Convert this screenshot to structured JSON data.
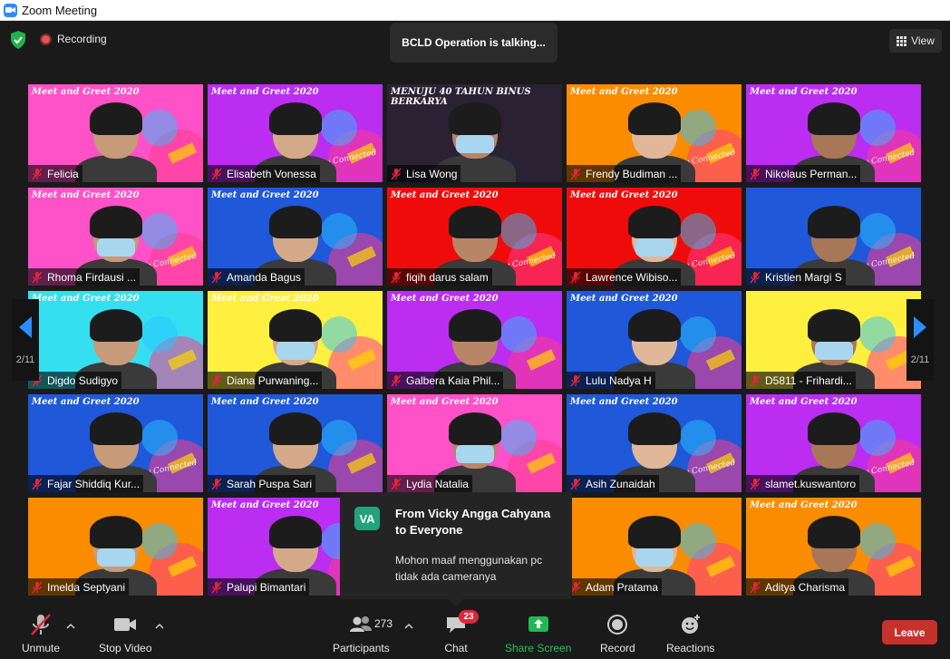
{
  "window": {
    "title": "Zoom Meeting"
  },
  "topbar": {
    "recording_label": "Recording",
    "talking_label": "BCLD Operation is talking...",
    "view_label": "View"
  },
  "pagination": {
    "left": "2/11",
    "right": "2/11"
  },
  "colors": {
    "pink": "#ff52c8",
    "purple": "#bb2df1",
    "orange": "#fb8c00",
    "red": "#f00b0b",
    "blue": "#1f58d8",
    "cyan": "#34e0f0",
    "yellow": "#fff040",
    "dark": "#2a2233"
  },
  "tiles": [
    {
      "name": "Felicia",
      "bg": "pink",
      "banner": "Meet and Greet 2020"
    },
    {
      "name": "Elisabeth Vonessa",
      "bg": "purple",
      "banner": "Meet and Greet 2020",
      "stay": "Stay Connected"
    },
    {
      "name": "Lisa Wong",
      "bg": "dark",
      "banner": "MENUJU 40 TAHUN BINUS BERKARYA"
    },
    {
      "name": "Frendy Budiman ...",
      "bg": "orange",
      "banner": "Meet and Greet 2020",
      "stay": "Stay Connected"
    },
    {
      "name": "Nikolaus Perman...",
      "bg": "purple",
      "banner": "Meet and Greet 2020",
      "stay": "Stay Connected"
    },
    {
      "name": "Rhoma Firdausi ...",
      "bg": "pink",
      "banner": "Meet and Greet 2020",
      "stay": "Stay Connected"
    },
    {
      "name": "Amanda Bagus",
      "bg": "blue",
      "banner": "Meet and Greet 2020"
    },
    {
      "name": "fiqih darus salam",
      "bg": "red",
      "banner": "Meet and Greet 2020",
      "stay": "Stay Connected"
    },
    {
      "name": "Lawrence Wibiso...",
      "bg": "red",
      "banner": "Meet and Greet 2020",
      "stay": "Stay Connected"
    },
    {
      "name": "Kristien Margi S",
      "bg": "blue",
      "banner": "",
      "stay": "Stay Connected"
    },
    {
      "name": "Digdo Sudigyo",
      "bg": "cyan",
      "banner": "Meet and Greet 2020"
    },
    {
      "name": "Diana Purwaning...",
      "bg": "yellow",
      "banner": "Meet and Greet 2020"
    },
    {
      "name": "Galbera Kaia Phil...",
      "bg": "purple",
      "banner": "Meet and Greet 2020"
    },
    {
      "name": "Lulu Nadya H",
      "bg": "blue",
      "banner": "Meet and Greet 2020"
    },
    {
      "name": "D5811 - Frihardi...",
      "bg": "yellow",
      "banner": ""
    },
    {
      "name": "Fajar Shiddiq Kur...",
      "bg": "blue",
      "banner": "Meet and Greet 2020",
      "stay": "Stay Connected"
    },
    {
      "name": "Sarah Puspa Sari",
      "bg": "blue",
      "banner": "Meet and Greet 2020"
    },
    {
      "name": "Lydia Natalia",
      "bg": "pink",
      "banner": "Meet and Greet 2020"
    },
    {
      "name": "Asih Zunaidah",
      "bg": "blue",
      "banner": "Meet and Greet 2020",
      "stay": "Stay Connected"
    },
    {
      "name": "slamet.kuswantoro",
      "bg": "purple",
      "banner": "Meet and Greet 2020",
      "stay": "Stay Connected"
    },
    {
      "name": "Imelda Septyani",
      "bg": "orange",
      "banner": ""
    },
    {
      "name": "Palupi Bimantari",
      "bg": "purple",
      "banner": "Meet and Greet 2020"
    },
    {
      "name": "",
      "bg": "dark",
      "banner": ""
    },
    {
      "name": "Adam Pratama",
      "bg": "orange",
      "banner": ""
    },
    {
      "name": "Aditya Charisma",
      "bg": "orange",
      "banner": "Meet and Greet 2020"
    }
  ],
  "chat_popup": {
    "avatar": "VA",
    "from": "From Vicky Angga Cahyana to Everyone",
    "message": "Mohon maaf menggunakan pc tidak ada cameranya"
  },
  "toolbar": {
    "unmute": "Unmute",
    "stop_video": "Stop Video",
    "participants": "Participants",
    "participant_count": "273",
    "chat": "Chat",
    "chat_badge": "23",
    "share_screen": "Share Screen",
    "record": "Record",
    "reactions": "Reactions",
    "leave": "Leave"
  }
}
